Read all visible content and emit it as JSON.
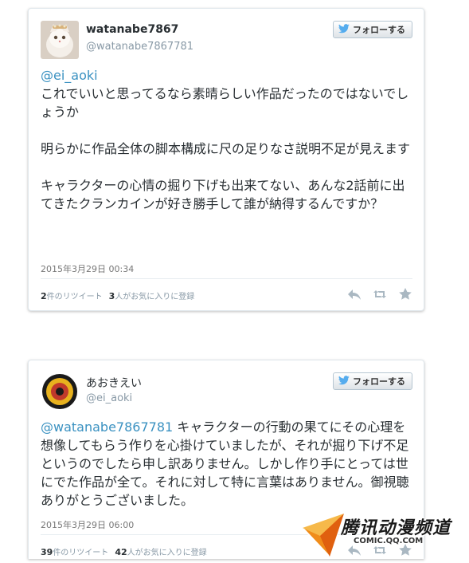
{
  "tweets": [
    {
      "display_name": "watanabe7867",
      "handle": "@watanabe7867781",
      "follow_label": "フォローする",
      "mention": "@ei_aoki",
      "body": "これでいいと思ってるなら素晴らしい作品だったのではないでしょうか\n\n明らかに作品全体の脚本構成に尺の足りなさ説明不足が見えます\n\nキャラクターの心情の掘り下げも出来てない、あんな2話前に出てきたクランカインが好き勝手して誰が納得するんですか？",
      "timestamp": "2015年3月29日 00:34",
      "retweet_count": "2",
      "retweet_label": "件のリツイート",
      "fav_count": "3",
      "fav_label": "人がお気に入りに登録"
    },
    {
      "display_name": "あおきえい",
      "handle": "@ei_aoki",
      "follow_label": "フォローする",
      "mention": "@watanabe7867781",
      "body": " キャラクターの行動の果てにその心理を想像してもらう作りを心掛けていましたが、それが掘り下げ不足というのでしたら申し訳ありません。しかし作り手にとっては世にでた作品が全て。それに対して特に言葉はありません。御視聴ありがとうございました。",
      "timestamp": "2015年3月29日 06:00",
      "retweet_count": "39",
      "retweet_label": "件のリツイート",
      "fav_count": "42",
      "fav_label": "人がお気に入りに登録"
    }
  ],
  "watermark": {
    "title": "腾讯动漫频道",
    "url": "COMIC.QQ.COM"
  },
  "icons": [
    "twitter-bird-icon",
    "reply-icon",
    "retweet-icon",
    "favorite-star-icon",
    "paper-plane-icon"
  ],
  "colors": {
    "mention": "#3a91c1",
    "twitter_blue": "#55acee",
    "action_gray": "#aab8c2"
  }
}
